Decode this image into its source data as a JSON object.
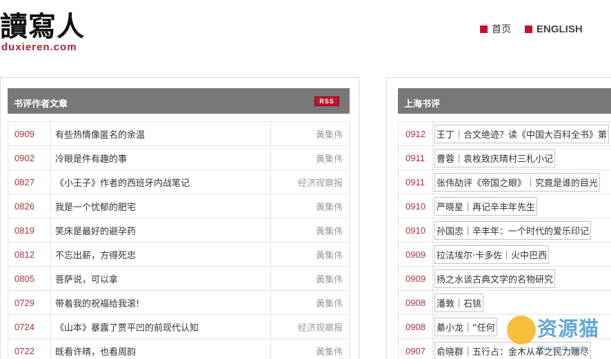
{
  "logo": {
    "cn": "讀寫人",
    "en": "duxieren.com"
  },
  "nav": [
    {
      "label": "首页"
    },
    {
      "label": "ENGLISH"
    }
  ],
  "left_panel": {
    "title": "书评作者文章",
    "rss_label": "RSS",
    "rows": [
      {
        "date": "0909",
        "title": "有些热情像匿名的余温",
        "author": "黃集伟"
      },
      {
        "date": "0902",
        "title": "冷眼是件有趣的事",
        "author": "黃集伟"
      },
      {
        "date": "0827",
        "title": "《小王子》作者的西班牙内战笔记",
        "author": "经济观察报"
      },
      {
        "date": "0826",
        "title": "我是一个忧郁的肥宅",
        "author": "黃集伟"
      },
      {
        "date": "0819",
        "title": "笑床是最好的避孕药",
        "author": "黃集伟"
      },
      {
        "date": "0812",
        "title": "不忘出薪，方得死忠",
        "author": "黃集伟"
      },
      {
        "date": "0805",
        "title": "菩萨说，可以拿",
        "author": "黃集伟"
      },
      {
        "date": "0729",
        "title": "带着我的祝福给我滚!",
        "author": "黃集伟"
      },
      {
        "date": "0724",
        "title": "《山本》暴露了贾平凹的前现代认知",
        "author": "经济观察报"
      },
      {
        "date": "0722",
        "title": "既看许晴，也看周韵",
        "author": "黃集伟"
      }
    ]
  },
  "right_panel": {
    "title": "上海书评",
    "rows": [
      {
        "date": "0912",
        "title": "王丁｜合文绝迹？读《中国大百科全书》第"
      },
      {
        "date": "0911",
        "title": "曹蓉｜袁枚致庆晴村三札小记"
      },
      {
        "date": "0911",
        "title": "张伟劼评《帝国之眼》｜究竟是谁的目光"
      },
      {
        "date": "0910",
        "title": "严晓星｜再记辛丰年先生"
      },
      {
        "date": "0910",
        "title": "孙国忠｜辛丰年：一个时代的爱乐印记"
      },
      {
        "date": "0909",
        "title": "拉法埃尔·卡多佐｜火中巴西"
      },
      {
        "date": "0909",
        "title": "扬之水谈古典文学的名物研究"
      },
      {
        "date": "0908",
        "title": "潘敦｜石铫"
      },
      {
        "date": "0908",
        "title": "綦小龙｜“任何"
      },
      {
        "date": "0907",
        "title": "俞晓群｜五行占：金木从革之民力雕尽"
      }
    ]
  },
  "watermark": {
    "text": "资源猫",
    "sub": "ziyuanm.com"
  }
}
